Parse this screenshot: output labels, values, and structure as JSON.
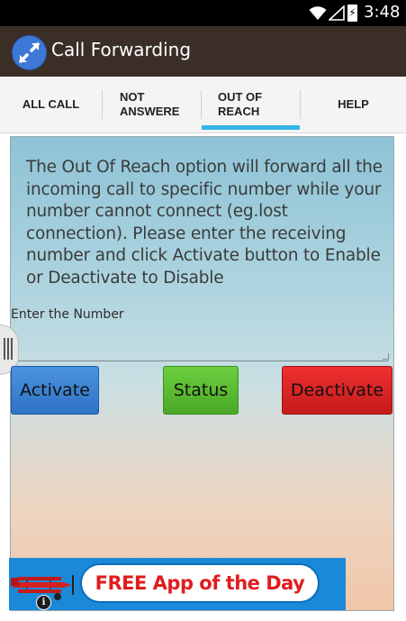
{
  "status_bar": {
    "time": "3:48",
    "icons": [
      "wifi-icon",
      "signal-icon",
      "battery-charging-icon"
    ]
  },
  "app": {
    "title": "Call Forwarding",
    "icon": "call-forward-arrows-icon",
    "accent": "#33b5e5"
  },
  "tabs": [
    {
      "label": "ALL CALL",
      "selected": false
    },
    {
      "label": "NOT\nANSWERE",
      "selected": false
    },
    {
      "label": "OUT OF\nREACH",
      "selected": true
    },
    {
      "label": "HELP",
      "selected": false
    }
  ],
  "content": {
    "description": "The Out Of Reach option will forward all the incoming call to specific number while your number cannot connect (eg.lost connection). Please enter the receiving number and click Activate button to Enable or Deactivate to Disable",
    "number_label": "Enter the Number",
    "number_value": ""
  },
  "buttons": {
    "activate": "Activate",
    "status": "Status",
    "deactivate": "Deactivate"
  },
  "ad": {
    "text": "FREE App of the Day",
    "info": "i",
    "icon": "airplane-icon"
  }
}
